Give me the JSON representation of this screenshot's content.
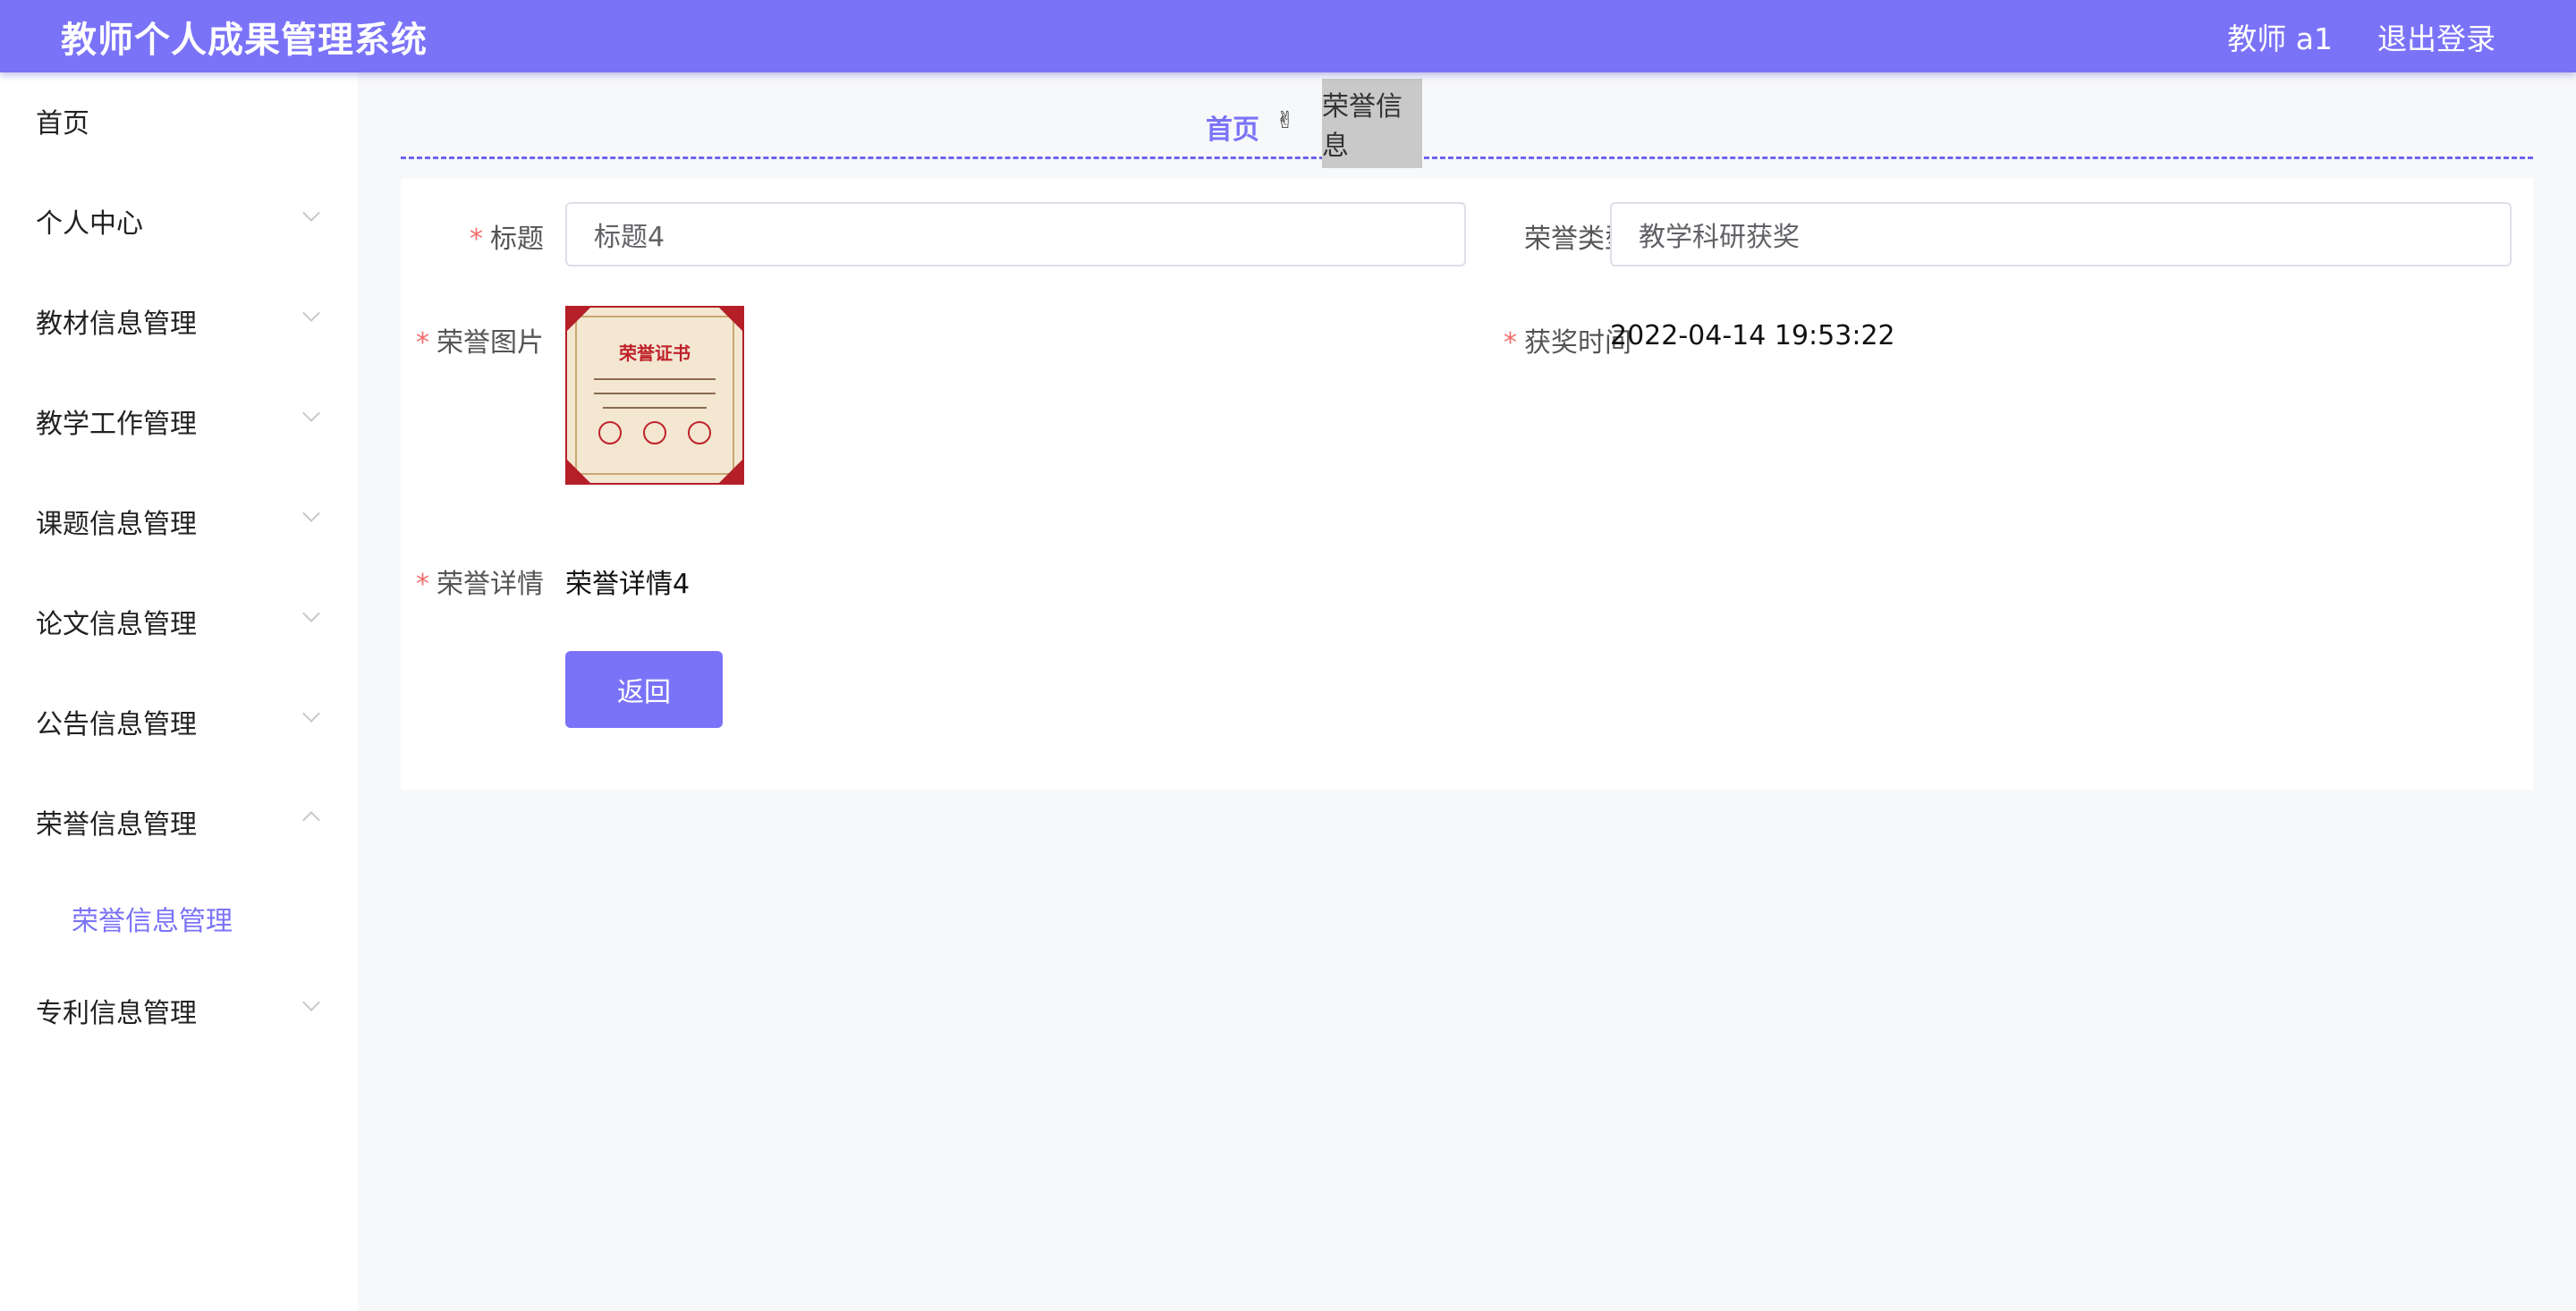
{
  "header": {
    "app_title": "教师个人成果管理系统",
    "user_label": "教师 a1",
    "logout_label": "退出登录"
  },
  "sidebar": {
    "items": [
      {
        "label": "首页"
      },
      {
        "label": "个人中心"
      },
      {
        "label": "教材信息管理"
      },
      {
        "label": "教学工作管理"
      },
      {
        "label": "课题信息管理"
      },
      {
        "label": "论文信息管理"
      },
      {
        "label": "公告信息管理"
      },
      {
        "label": "荣誉信息管理",
        "expanded": true,
        "submenu": [
          {
            "label": "荣誉信息管理",
            "active": true
          }
        ]
      },
      {
        "label": "专利信息管理"
      }
    ]
  },
  "breadcrumb": {
    "home": "首页",
    "separator": "✌",
    "current": "荣誉信息"
  },
  "form": {
    "title_label": "标题",
    "title_value": "标题4",
    "type_label": "荣誉类型",
    "type_value": "教学科研获奖",
    "image_label": "荣誉图片",
    "time_label": "获奖时间",
    "time_value": "2022-04-14 19:53:22",
    "detail_label": "荣誉详情",
    "detail_value": "荣誉详情4",
    "back_label": "返回",
    "required_mark": "*"
  },
  "certificate": {
    "heading": "荣誉证书"
  },
  "colors": {
    "accent": "#7b73f7",
    "required": "#f56c6c"
  }
}
